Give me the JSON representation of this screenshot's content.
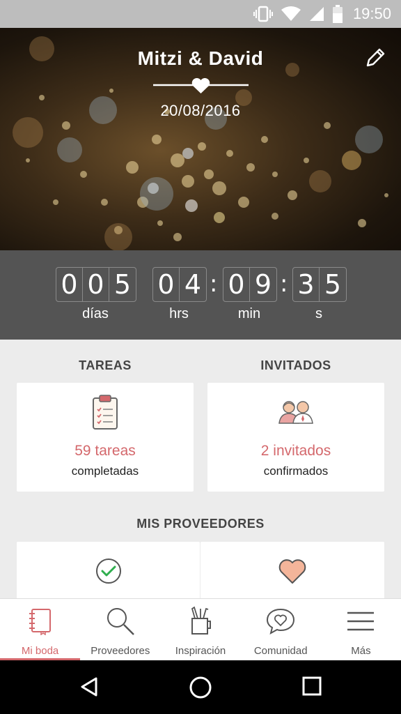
{
  "status_bar": {
    "time": "19:50",
    "icons": [
      "vibrate-icon",
      "wifi-icon",
      "signal-icon",
      "battery-icon"
    ]
  },
  "hero": {
    "couple_names": "Mitzi & David",
    "wedding_date": "20/08/2016",
    "edit_icon": "pencil-icon"
  },
  "countdown": {
    "days": [
      "0",
      "0",
      "5"
    ],
    "hours": [
      "0",
      "4"
    ],
    "minutes": [
      "0",
      "9"
    ],
    "seconds": [
      "3",
      "5"
    ],
    "labels": {
      "days": "días",
      "hours": "hrs",
      "minutes": "min",
      "seconds": "s"
    }
  },
  "tasks": {
    "title": "TAREAS",
    "count": "59 tareas",
    "sub": "completadas",
    "icon": "clipboard-icon"
  },
  "guests": {
    "title": "INVITADOS",
    "count": "2 invitados",
    "sub": "confirmados",
    "icon": "couple-icon"
  },
  "vendors": {
    "title": "MIS PROVEEDORES",
    "cards": [
      {
        "icon": "checkmark-circle-icon"
      },
      {
        "icon": "heart-icon"
      }
    ]
  },
  "bottom_nav": {
    "items": [
      {
        "label": "Mi boda",
        "icon": "notebook-icon",
        "active": true
      },
      {
        "label": "Proveedores",
        "icon": "search-icon",
        "active": false
      },
      {
        "label": "Inspiración",
        "icon": "pencil-cup-icon",
        "active": false
      },
      {
        "label": "Comunidad",
        "icon": "chat-heart-icon",
        "active": false
      },
      {
        "label": "Más",
        "icon": "menu-icon",
        "active": false
      }
    ]
  },
  "colors": {
    "accent": "#d4686c",
    "countdown_bg": "#545454",
    "page_bg": "#ececec",
    "status_bar": "#bdbdbd"
  }
}
